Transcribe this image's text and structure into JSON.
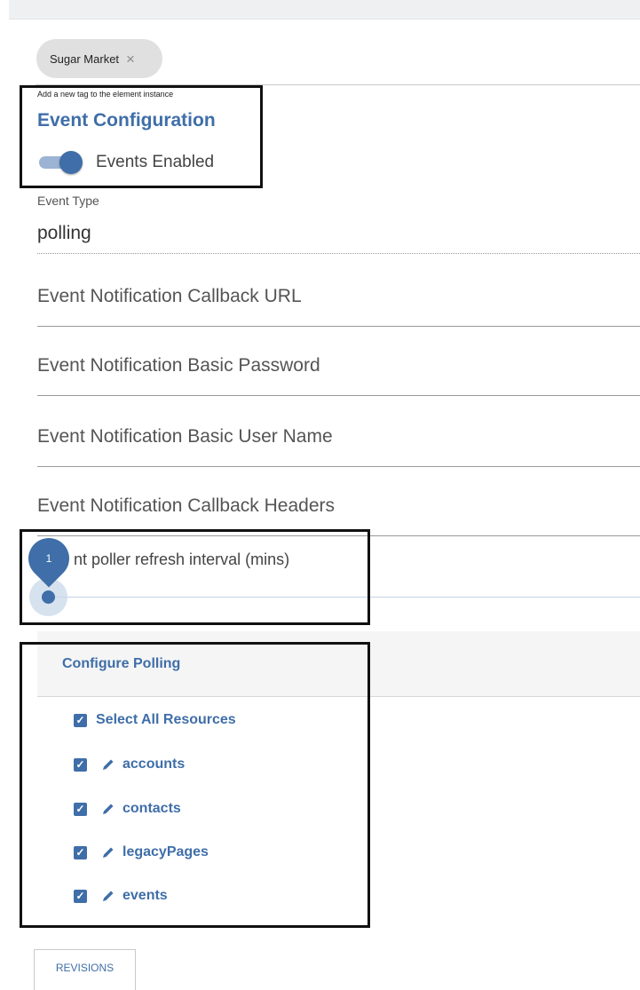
{
  "tag": {
    "label": "Sugar Market",
    "remove_icon": "close-icon"
  },
  "tag_hint": "Add a new tag to the element instance",
  "event_config": {
    "title": "Event Configuration",
    "toggle_label": "Events Enabled",
    "toggle_on": true
  },
  "event_type": {
    "label": "Event Type",
    "value": "polling"
  },
  "fields": [
    {
      "placeholder": "Event Notification Callback URL"
    },
    {
      "placeholder": "Event Notification Basic Password"
    },
    {
      "placeholder": "Event Notification Basic User Name"
    },
    {
      "placeholder": "Event Notification Callback Headers"
    }
  ],
  "poller": {
    "label_visible": "nt poller refresh interval (mins)",
    "value": "1"
  },
  "polling": {
    "title": "Configure Polling",
    "select_all": "Select All Resources",
    "resources": [
      "accounts",
      "contacts",
      "legacyPages",
      "events"
    ],
    "checkbox_icon": "check-icon",
    "edit_icon": "pencil-icon"
  },
  "footer": {
    "revisions": "REVISIONS"
  },
  "colors": {
    "accent": "#3f6ea8",
    "chip": "#e0e0e0",
    "toggle_track": "#9cb3d4"
  }
}
